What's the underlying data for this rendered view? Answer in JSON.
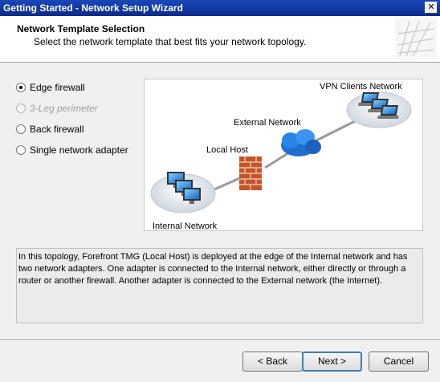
{
  "window": {
    "title": "Getting Started - Network Setup Wizard",
    "close_glyph": "✕"
  },
  "header": {
    "title": "Network Template Selection",
    "subtitle": "Select the network template that best fits your network topology."
  },
  "options": [
    {
      "label": "Edge firewall",
      "checked": true,
      "enabled": true
    },
    {
      "label": "3-Leg perimeter",
      "checked": false,
      "enabled": false
    },
    {
      "label": "Back firewall",
      "checked": false,
      "enabled": true
    },
    {
      "label": "Single network adapter",
      "checked": false,
      "enabled": true
    }
  ],
  "diagram": {
    "vpn_label": "VPN Clients Network",
    "external_label": "External Network",
    "local_host_label": "Local Host",
    "internal_label": "Internal Network"
  },
  "description": "In this topology, Forefront TMG (Local Host) is deployed at the edge of the Internal network and has two network adapters. One adapter is connected to the Internal network, either directly or through a router or another firewall. Another adapter is connected to the External network (the Internet).",
  "buttons": {
    "back": "< Back",
    "next": "Next >",
    "cancel": "Cancel"
  },
  "colors": {
    "titlebar": "#0a2b8c",
    "cloud": "#1f6fd1",
    "firewall": "#c4552b",
    "default_button_border": "#3c7fb1"
  }
}
